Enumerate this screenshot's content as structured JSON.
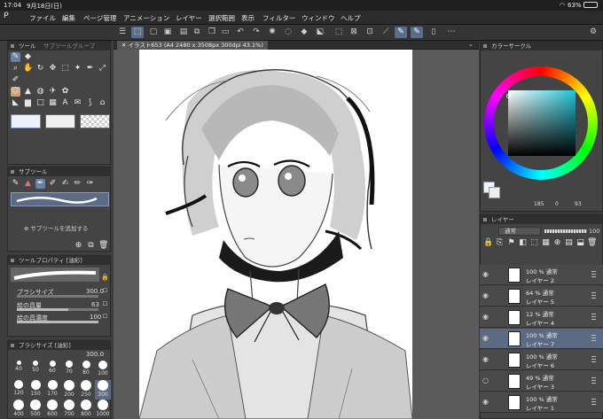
{
  "status": {
    "time": "17:04",
    "date": "9月18日(日)",
    "battery": "63%"
  },
  "menu": [
    "ファイル",
    "編集",
    "ページ管理",
    "アニメーション",
    "レイヤー",
    "選択範囲",
    "表示",
    "フィルター",
    "ウィンドウ",
    "ヘルプ"
  ],
  "tool_panel": {
    "title": "ツール",
    "tab2": "サブツールグループ"
  },
  "subtool_panel": {
    "title": "サブツール",
    "add_label": "サブツールを追加する"
  },
  "props_panel": {
    "title": "ツールプロパティ [油彩]",
    "rows": [
      {
        "label": "ブラシサイズ",
        "value": "300.0"
      },
      {
        "label": "絵の具量",
        "value": "63"
      },
      {
        "label": "絵の具濃度",
        "value": "100"
      }
    ]
  },
  "brushsize_panel": {
    "title": "ブラシサイズ [油彩]",
    "top_value": "300.0"
  },
  "brush_sizes": [
    "40",
    "50",
    "60",
    "70",
    "80",
    "100",
    "120",
    "150",
    "170",
    "200",
    "250",
    "300",
    "400",
    "500",
    "600",
    "700",
    "800",
    "1000"
  ],
  "canvas": {
    "tab_title": "イラスト653 (A4 2480 x 3508px 300dpi 43.1%)"
  },
  "color_panel": {
    "title": "カラーサークル",
    "values": [
      "185",
      "0",
      "93"
    ]
  },
  "layer_panel": {
    "title": "レイヤー",
    "blend_mode": "通常",
    "opacity": "100"
  },
  "layers": [
    {
      "opacity": "100 %",
      "mode": "通常",
      "name": "レイヤー 2"
    },
    {
      "opacity": "64 %",
      "mode": "通常",
      "name": "レイヤー 5"
    },
    {
      "opacity": "12 %",
      "mode": "通常",
      "name": "レイヤー 4"
    },
    {
      "opacity": "100 %",
      "mode": "通常",
      "name": "レイヤー 7"
    },
    {
      "opacity": "100 %",
      "mode": "通常",
      "name": "レイヤー 6"
    },
    {
      "opacity": "49 %",
      "mode": "通常",
      "name": "レイヤー 3"
    },
    {
      "opacity": "100 %",
      "mode": "通常",
      "name": "レイヤー 1"
    }
  ],
  "colors": {
    "accent": "#5a6e8c",
    "selected_layer": "#5d6a84",
    "panel": "#444444"
  }
}
